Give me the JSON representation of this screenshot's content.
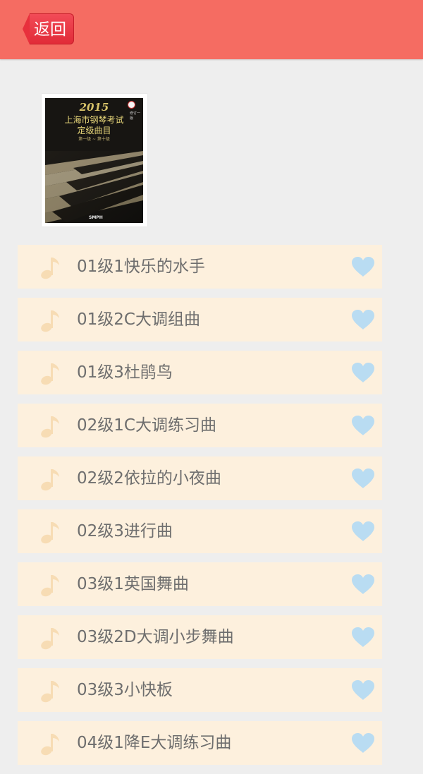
{
  "header": {
    "back_label": "返回"
  },
  "album": {
    "cover": {
      "year": "2015",
      "title_line1": "上海市钢琴考试",
      "title_line2": "定级曲目",
      "subtitle": "第一级 ~ 第十级",
      "edition": "修订一版",
      "publisher_logo": "SMPH"
    }
  },
  "songs": [
    {
      "title": "01级1快乐的水手",
      "icon": "music-note-icon",
      "fav_icon": "heart-icon"
    },
    {
      "title": "01级2C大调组曲",
      "icon": "music-note-icon",
      "fav_icon": "heart-icon"
    },
    {
      "title": "01级3杜鹃鸟",
      "icon": "music-note-icon",
      "fav_icon": "heart-icon"
    },
    {
      "title": "02级1C大调练习曲",
      "icon": "music-note-icon",
      "fav_icon": "heart-icon"
    },
    {
      "title": "02级2依拉的小夜曲",
      "icon": "music-note-icon",
      "fav_icon": "heart-icon"
    },
    {
      "title": "02级3进行曲",
      "icon": "music-note-icon",
      "fav_icon": "heart-icon"
    },
    {
      "title": "03级1英国舞曲",
      "icon": "music-note-icon",
      "fav_icon": "heart-icon"
    },
    {
      "title": "03级2D大调小步舞曲",
      "icon": "music-note-icon",
      "fav_icon": "heart-icon"
    },
    {
      "title": "03级3小快板",
      "icon": "music-note-icon",
      "fav_icon": "heart-icon"
    },
    {
      "title": "04级1降E大调练习曲",
      "icon": "music-note-icon",
      "fav_icon": "heart-icon"
    }
  ],
  "colors": {
    "header_bg": "#f56c62",
    "back_button": "#e8303c",
    "page_bg": "#eeeeee",
    "row_bg": "#fdf0dd",
    "note_icon": "#f7dcb4",
    "heart_icon": "#b9dcf2",
    "row_text": "#6e6e6e"
  }
}
